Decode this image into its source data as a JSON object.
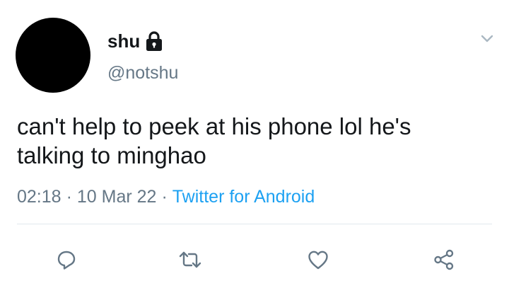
{
  "tweet": {
    "author": {
      "display_name": "shu",
      "handle": "@notshu",
      "avatar_color": "#000000",
      "protected_icon": "lock-icon"
    },
    "text_line1": "can't help to peek at his phone lol he's",
    "text_line2": "talking to minghao",
    "time": "02:18",
    "separator": "·",
    "date": "10 Mar 22",
    "source": "Twitter for Android"
  },
  "actions": [
    "reply-icon",
    "retweet-icon",
    "like-icon",
    "share-icon"
  ],
  "colors": {
    "text": "#14171a",
    "secondary": "#657786",
    "link": "#1da1f2",
    "icon": "#657786",
    "divider": "#e1e8ed"
  }
}
